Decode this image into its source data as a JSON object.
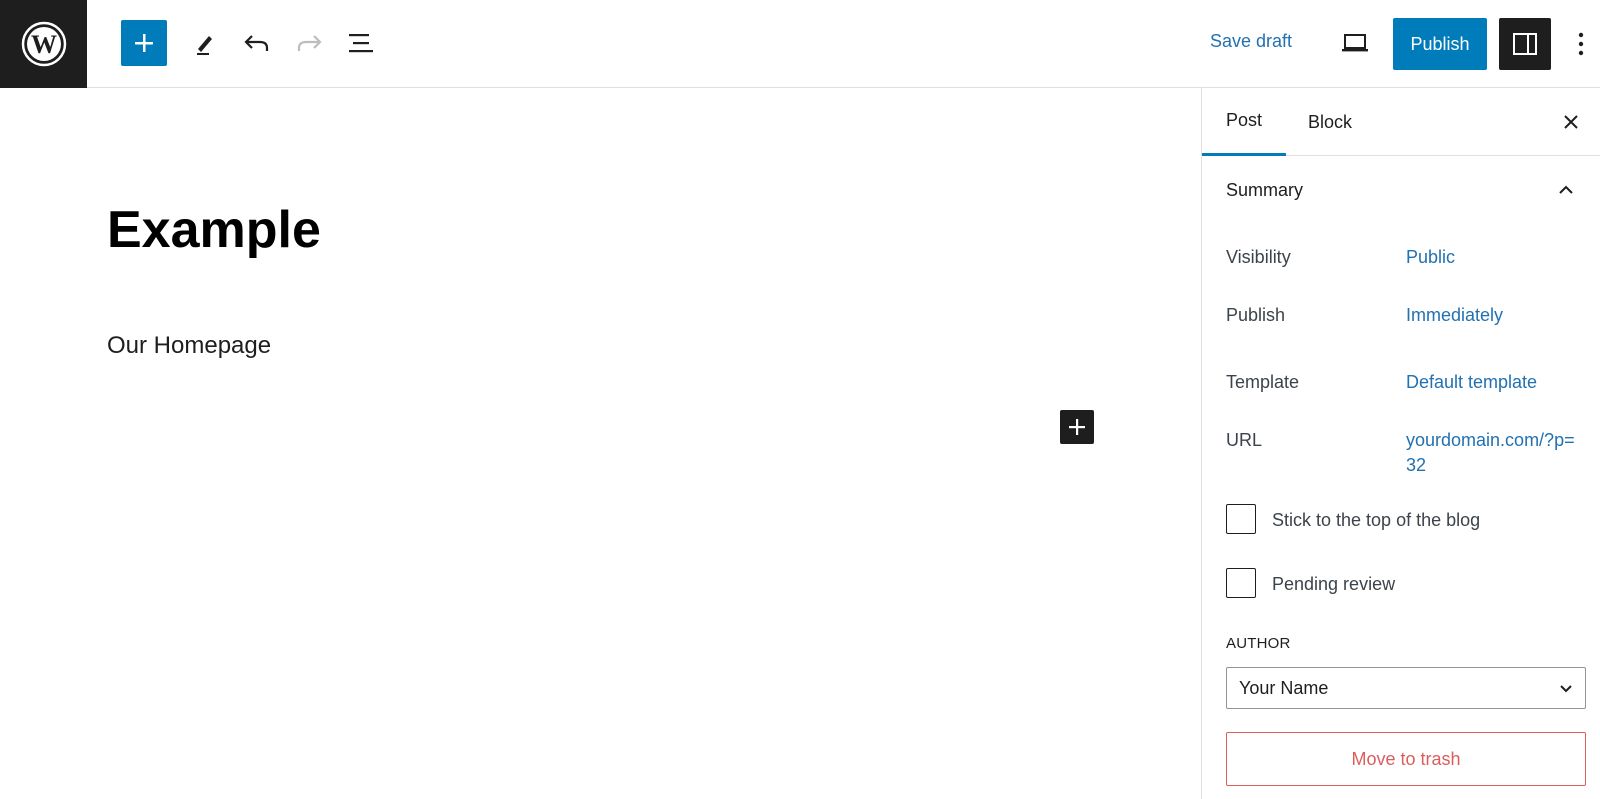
{
  "toolbar": {
    "save_draft": "Save draft",
    "publish": "Publish"
  },
  "post": {
    "title": "Example",
    "paragraph": "Our Homepage"
  },
  "sidebar": {
    "tabs": [
      {
        "label": "Post",
        "active": true
      },
      {
        "label": "Block",
        "active": false
      }
    ],
    "summary_title": "Summary",
    "rows": [
      {
        "label": "Visibility",
        "value": "Public"
      },
      {
        "label": "Publish",
        "value": "Immediately"
      },
      {
        "label": "Template",
        "value": "Default template"
      },
      {
        "label": "URL",
        "value": "yourdomain.com/?p=32"
      }
    ],
    "checkboxes": [
      {
        "label": "Stick to the top of the blog",
        "checked": false
      },
      {
        "label": "Pending review",
        "checked": false
      }
    ],
    "author_label": "AUTHOR",
    "author_value": "Your Name",
    "trash": "Move to trash"
  },
  "colors": {
    "accent": "#007cba",
    "link": "#2271b1",
    "dark": "#1e1e1e",
    "danger": "#cc1818"
  }
}
